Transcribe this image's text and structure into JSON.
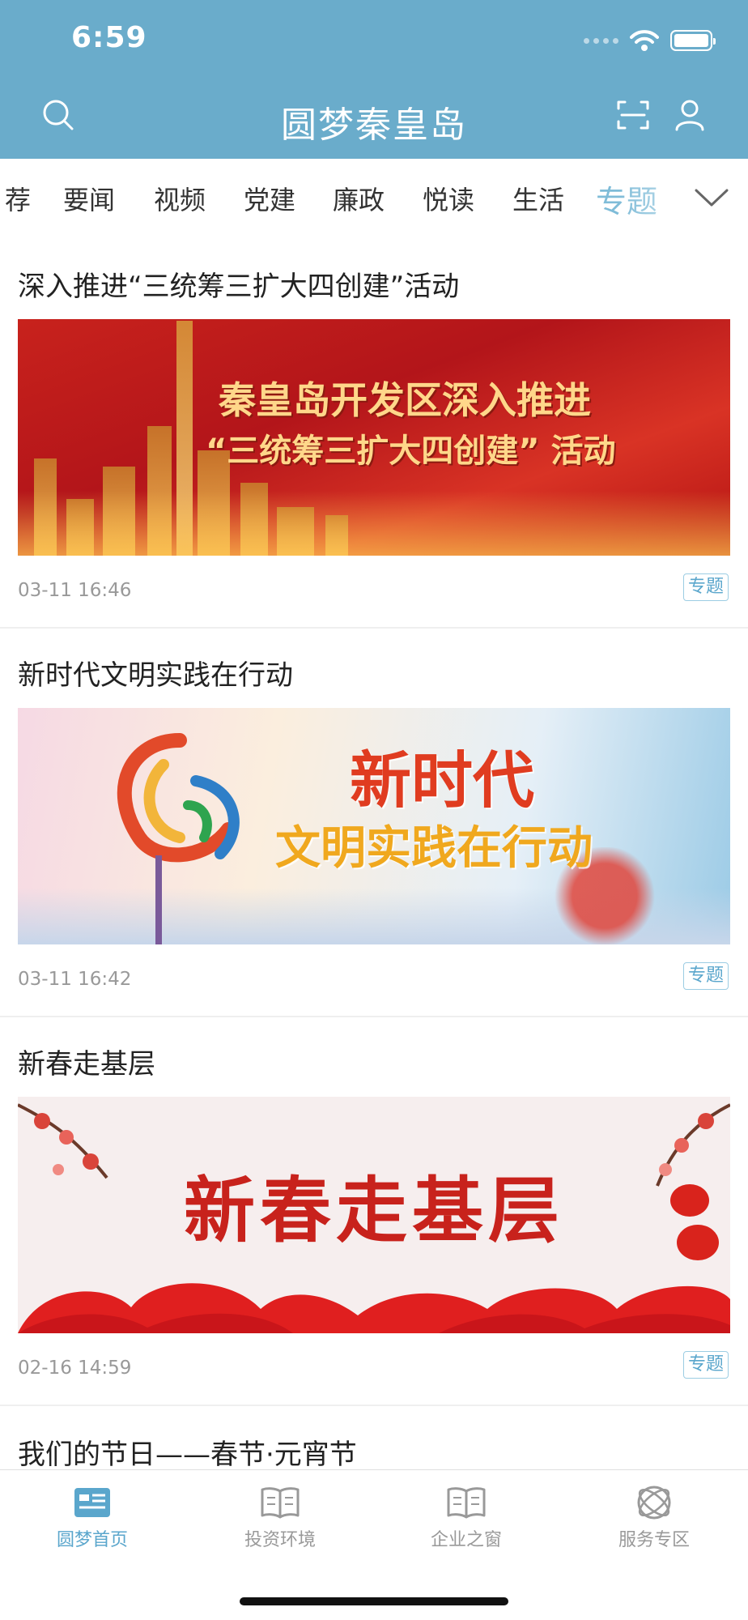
{
  "status_bar": {
    "time": "6:59"
  },
  "header": {
    "title": "圆梦秦皇岛"
  },
  "icons": {
    "search": "search-icon",
    "scan": "scan-icon",
    "user": "user-icon",
    "more": "chevron-down-icon"
  },
  "colors": {
    "header_bg": "#6aaccb",
    "accent": "#5aa6cc",
    "active_tab": "#7fbcd8"
  },
  "tabs": [
    "荐",
    "要闻",
    "视频",
    "党建",
    "廉政",
    "悦读",
    "生活",
    "专题"
  ],
  "active_tab": "专题",
  "articles": [
    {
      "title": "深入推进“三统筹三扩大四创建”活动",
      "banner_line1": "秦皇岛开发区深入推进",
      "banner_line2": "“三统筹三扩大四创建” 活动",
      "time": "03-11 16:46",
      "badge": "专题"
    },
    {
      "title": "新时代文明实践在行动",
      "banner_line1": "新时代",
      "banner_line2": "文明实践在行动",
      "time": "03-11 16:42",
      "badge": "专题"
    },
    {
      "title": "新春走基层",
      "banner_line1": "新春走基层",
      "time": "02-16 14:59",
      "badge": "专题"
    },
    {
      "title": "我们的节日——春节·元宵节"
    }
  ],
  "bottom_nav": [
    {
      "label": "圆梦首页",
      "icon": "news-icon",
      "active": true
    },
    {
      "label": "投资环境",
      "icon": "book-icon",
      "active": false
    },
    {
      "label": "企业之窗",
      "icon": "book-icon",
      "active": false
    },
    {
      "label": "服务专区",
      "icon": "orbit-icon",
      "active": false
    }
  ]
}
